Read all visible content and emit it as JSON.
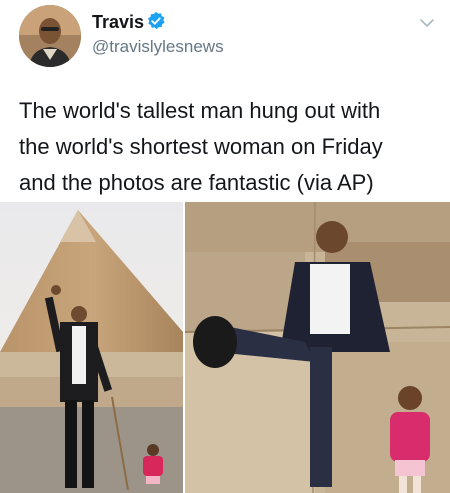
{
  "tweet": {
    "author_name": "Travis",
    "author_handle": "@travislylesnews",
    "lines": [
      "The world's tallest man hung out with",
      "the world's shortest woman on Friday",
      "and the photos are fantastic (via AP)"
    ]
  },
  "icons": {
    "verified": "verified-badge-icon",
    "menu": "chevron-down-icon"
  },
  "colors": {
    "verified_blue": "#1da1f2",
    "text_primary": "#14171a",
    "text_secondary": "#657786"
  }
}
